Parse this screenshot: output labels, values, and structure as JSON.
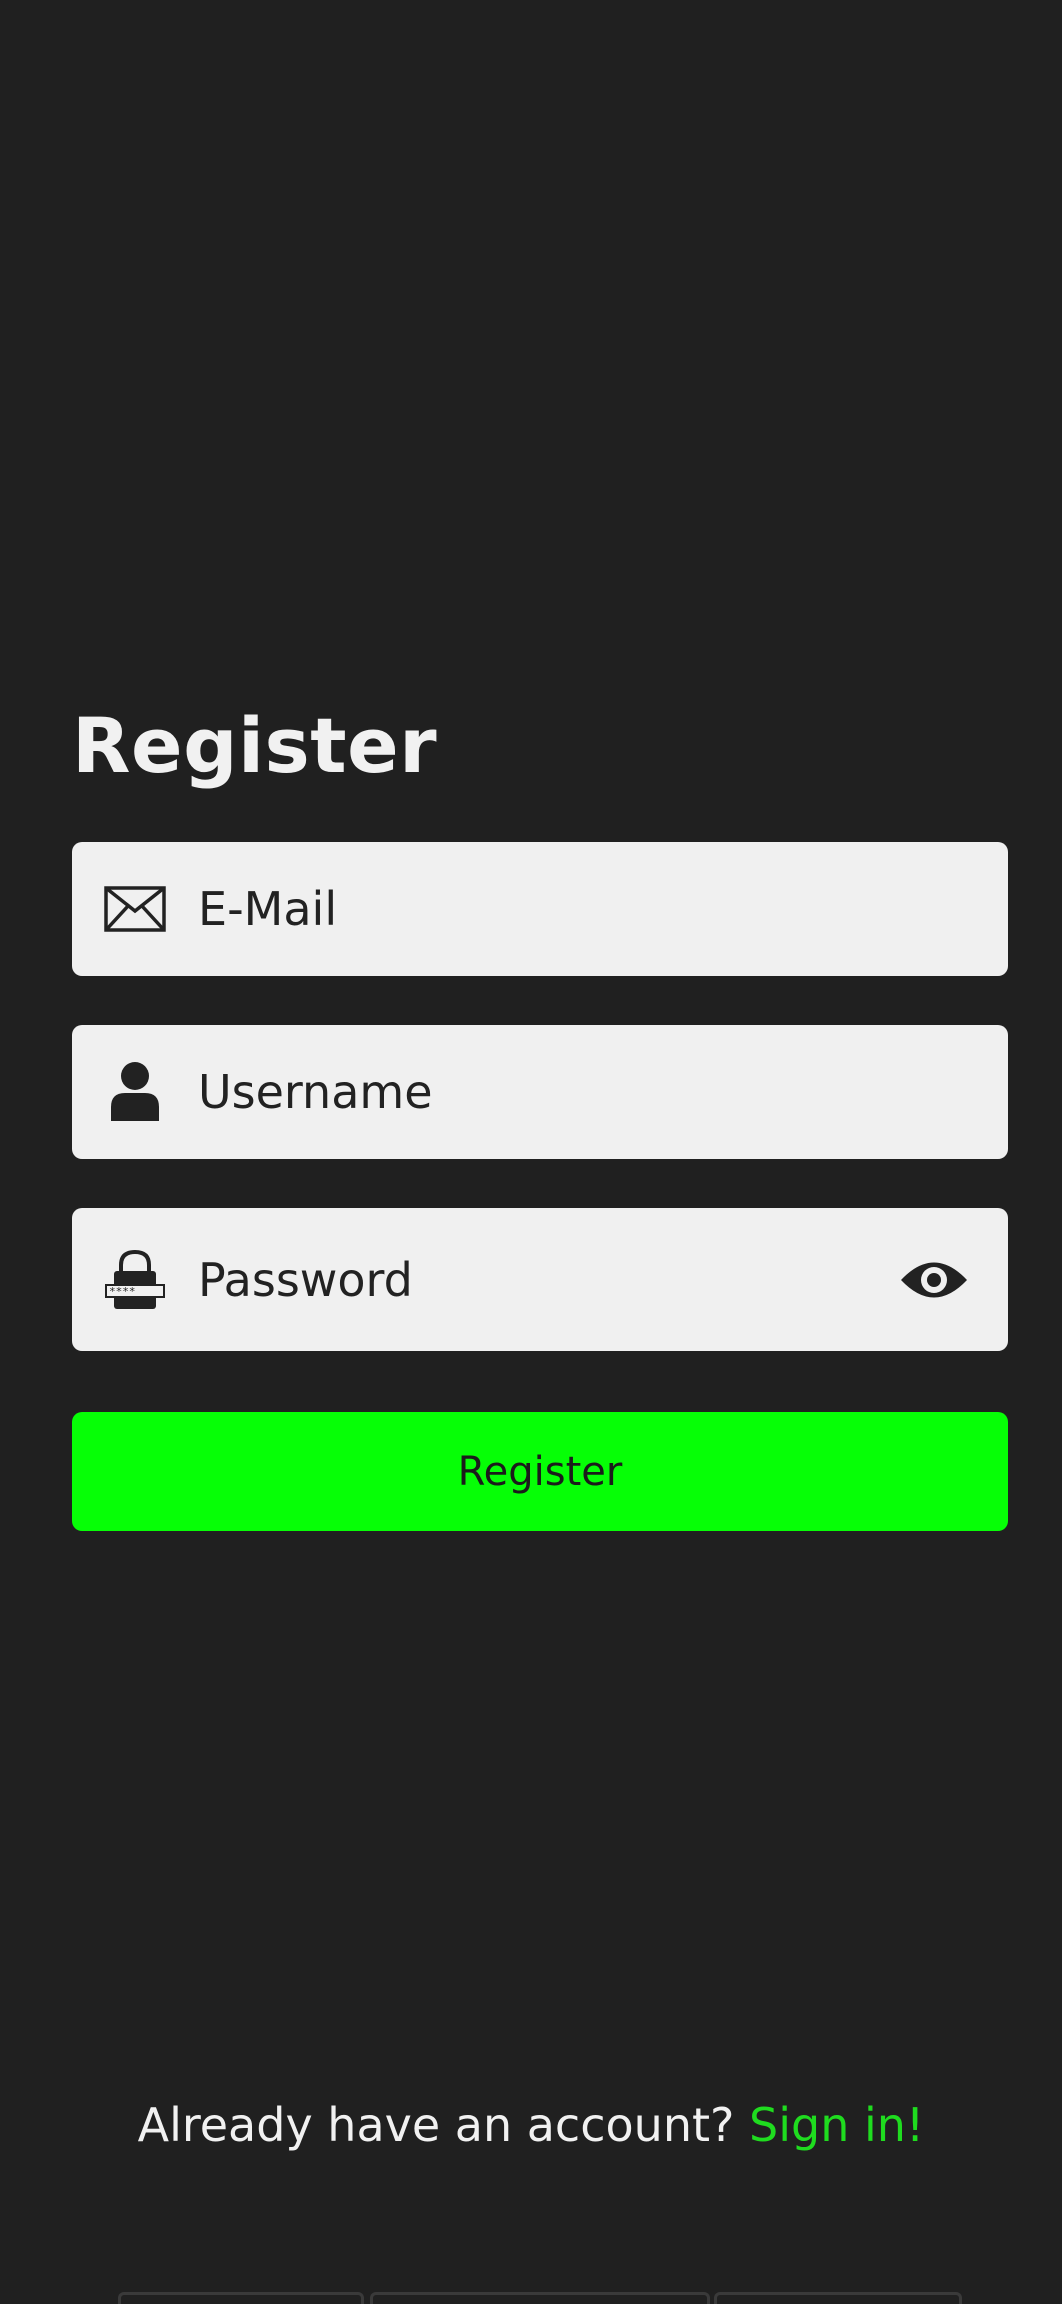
{
  "page": {
    "title": "Register",
    "background_color": "#202020",
    "accent_color": "#06ff06",
    "link_color": "#1fdc1f"
  },
  "form": {
    "email": {
      "placeholder": "E-Mail",
      "value": "",
      "icon": "envelope-icon"
    },
    "username": {
      "placeholder": "Username",
      "value": "",
      "icon": "person-icon"
    },
    "password": {
      "placeholder": "Password",
      "value": "",
      "icon": "lock-icon",
      "toggle_icon": "eye-icon"
    },
    "submit_label": "Register"
  },
  "footer": {
    "prompt": "Already have an account? ",
    "link_label": "Sign in!"
  },
  "system_nav": {
    "items": [
      "nav-segment-1",
      "nav-segment-2",
      "nav-segment-3"
    ]
  }
}
